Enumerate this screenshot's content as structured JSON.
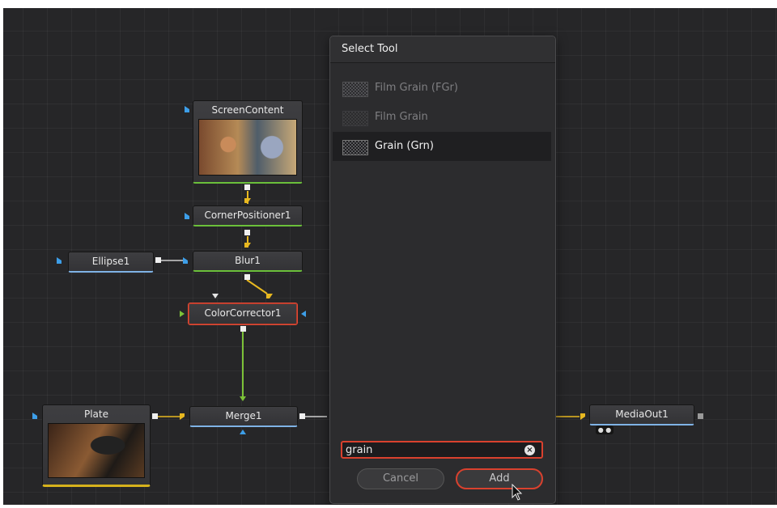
{
  "dialog": {
    "title": "Select Tool",
    "tools": [
      {
        "name": "Film Grain (FGr)",
        "icon": "film-grain-tool-icon",
        "selected": false
      },
      {
        "name": "Film Grain",
        "icon": "film-grain-macro-icon",
        "selected": false
      },
      {
        "name": "Grain (Grn)",
        "icon": "grain-tool-icon",
        "selected": true
      }
    ],
    "search_value": "grain",
    "clear_icon": "×",
    "cancel_label": "Cancel",
    "add_label": "Add"
  },
  "nodes": {
    "screen_content": "ScreenContent",
    "corner_positioner": "CornerPositioner1",
    "blur": "Blur1",
    "ellipse": "Ellipse1",
    "color_corrector": "ColorCorrector1",
    "plate": "Plate",
    "merge": "Merge1",
    "media_out": "MediaOut1"
  },
  "colors": {
    "accent": "#d9412e",
    "wire_yellow": "#e8b820",
    "wire_green": "#7cc238",
    "wire_blue": "#3d9ee8",
    "background": "#262628"
  }
}
